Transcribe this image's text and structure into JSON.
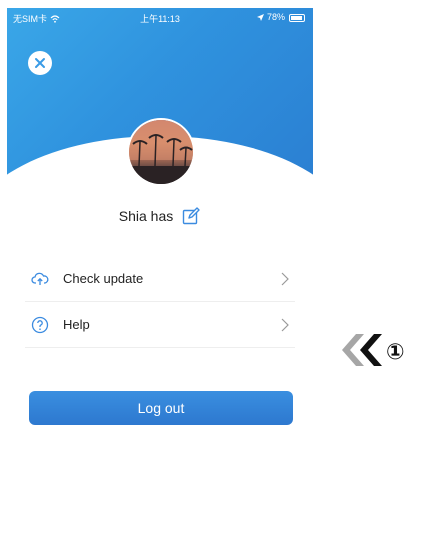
{
  "status_bar": {
    "carrier": "无SIM卡 ",
    "time": "上午11:13",
    "battery": "78%"
  },
  "profile": {
    "username": "Shia has"
  },
  "menu": {
    "items": [
      {
        "label": "Check update",
        "icon": "cloud-update-icon"
      },
      {
        "label": "Help",
        "icon": "help-icon"
      }
    ]
  },
  "actions": {
    "logout_label": "Log out"
  },
  "annotation": {
    "marker": "①"
  },
  "colors": {
    "header_blue": "#2f92de",
    "button_blue": "#2d78cf",
    "accent_icon": "#3b8be0"
  }
}
